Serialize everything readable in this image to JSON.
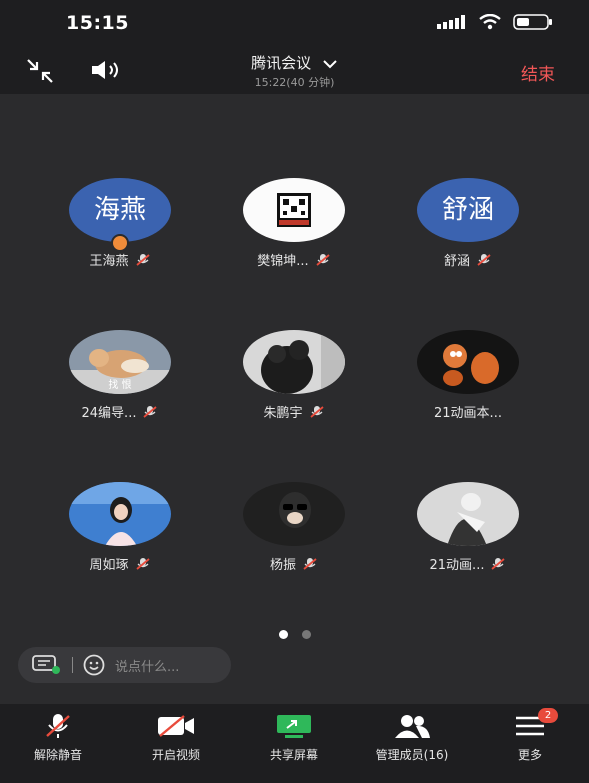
{
  "status_bar": {
    "time": "15:15"
  },
  "header": {
    "title": "腾讯会议",
    "subtitle": "15:22(40 分钟)",
    "end_label": "结束"
  },
  "participants": [
    {
      "name": "王海燕",
      "avatar_text": "海燕",
      "avatar_type": "text",
      "host": true
    },
    {
      "name": "樊锦坤...",
      "avatar_type": "qr"
    },
    {
      "name": "舒涵",
      "avatar_text": "舒涵",
      "avatar_type": "text"
    },
    {
      "name": "24编导...",
      "avatar_type": "photo",
      "avatar_overlay": "找 恨"
    },
    {
      "name": "朱鹏宇",
      "avatar_type": "photo"
    },
    {
      "name": "21动画本...",
      "avatar_type": "photo"
    },
    {
      "name": "周如琢",
      "avatar_type": "photo"
    },
    {
      "name": "杨振",
      "avatar_type": "photo"
    },
    {
      "name": "21动画...",
      "avatar_type": "photo"
    }
  ],
  "pager": {
    "pages": 2,
    "current": 1
  },
  "chat": {
    "placeholder": "说点什么..."
  },
  "toolbar": {
    "unmute": "解除静音",
    "video": "开启视频",
    "share": "共享屏幕",
    "members": "管理成员(16)",
    "more": "更多",
    "more_badge": "2"
  },
  "colors": {
    "accent": "#3b63b0",
    "end": "#f25757",
    "share": "#2fb85a",
    "badge": "#e84b3c"
  }
}
